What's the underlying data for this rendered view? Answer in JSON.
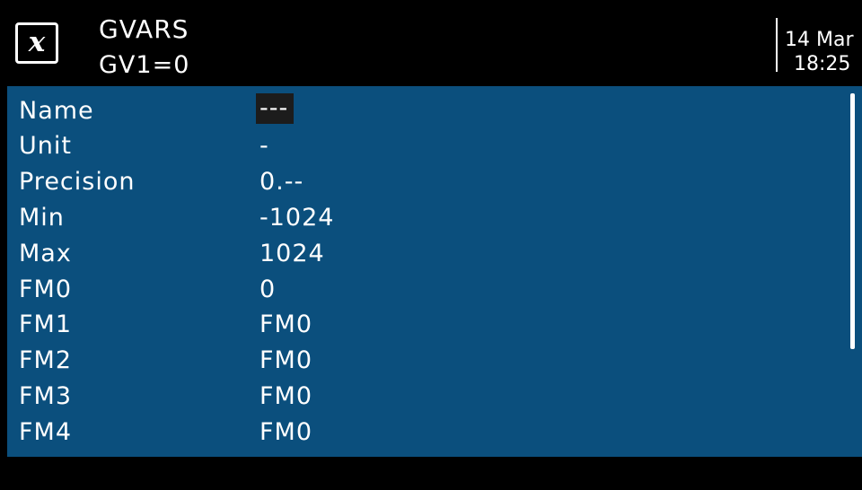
{
  "header": {
    "logo_glyph": "x",
    "title": "GVARS",
    "subtitle": "GV1=0",
    "date": "14 Mar",
    "time": "18:25"
  },
  "fields": [
    {
      "label": "Name",
      "value": "---"
    },
    {
      "label": "Unit",
      "value": "-"
    },
    {
      "label": "Precision",
      "value": "0.--"
    },
    {
      "label": "Min",
      "value": "-1024"
    },
    {
      "label": "Max",
      "value": "1024"
    },
    {
      "label": "FM0",
      "value": "0"
    },
    {
      "label": "FM1",
      "value": "FM0"
    },
    {
      "label": "FM2",
      "value": "FM0"
    },
    {
      "label": "FM3",
      "value": "FM0"
    },
    {
      "label": "FM4",
      "value": "FM0"
    }
  ],
  "colors": {
    "panel": "#0b4f7d",
    "background": "#000000",
    "text": "#ffffff",
    "focus": "#1c1c1c"
  }
}
